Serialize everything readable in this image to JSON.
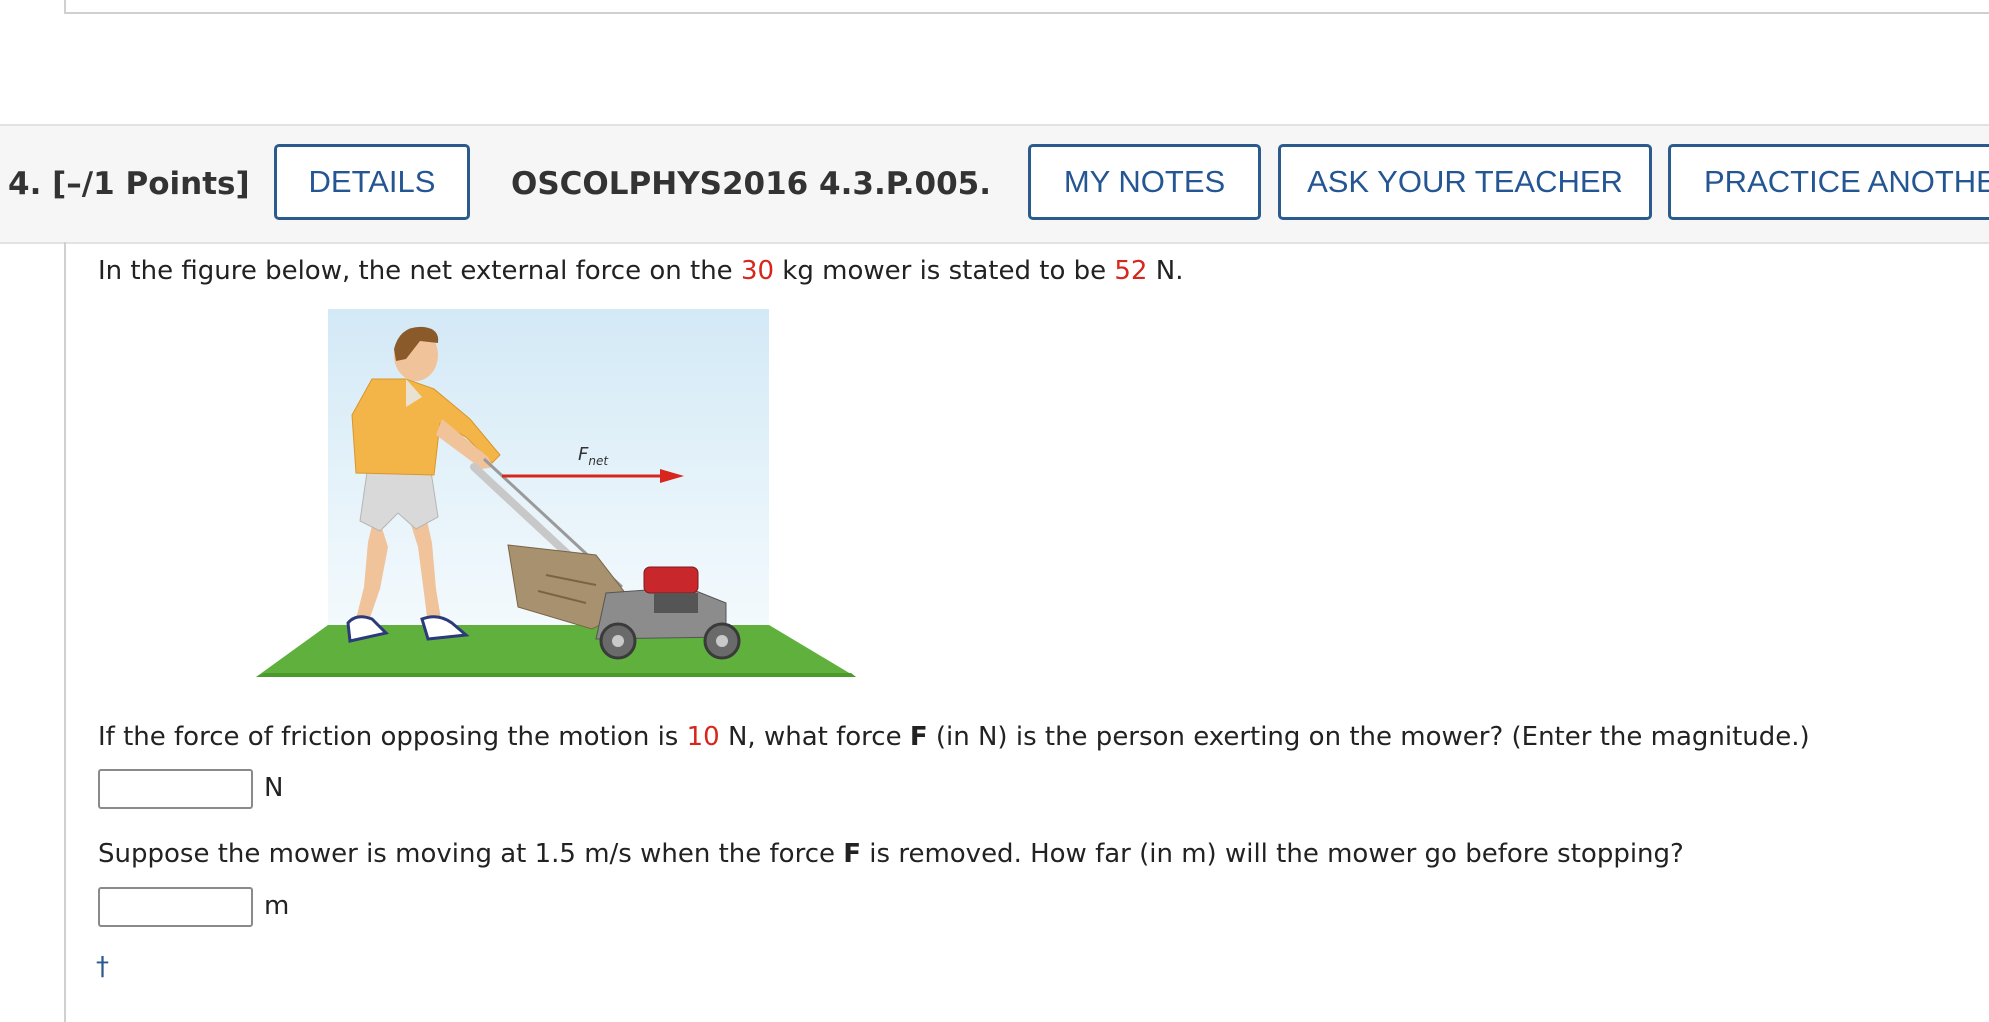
{
  "question": {
    "label": "4.  [–/1 Points]",
    "details_button": "DETAILS",
    "code": "OSCOLPHYS2016 4.3.P.005.",
    "my_notes_button": "MY NOTES",
    "ask_teacher_button": "ASK YOUR TEACHER",
    "practice_button": "PRACTICE ANOTHE"
  },
  "intro": {
    "prefix": "In the figure below, the net external force on the ",
    "mass": "30",
    "mid": " kg mower is stated to be ",
    "force": "52",
    "suffix": " N."
  },
  "figure": {
    "arrow_label": "F",
    "arrow_subscript": "net"
  },
  "part1": {
    "prefix": "If the force of friction opposing the motion is ",
    "friction": "10",
    "mid": " N, what force ",
    "bold": "F",
    "suffix": " (in N) is the person exerting on the mower? (Enter the magnitude.)",
    "unit": "N",
    "value": ""
  },
  "part2": {
    "prefix": "Suppose the mower is moving at 1.5 m/s when the force ",
    "bold": "F",
    "suffix": " is removed. How far (in m) will the mower go before stopping?",
    "unit": "m",
    "value": ""
  },
  "footnote_symbol": "†",
  "colors": {
    "accent": "#2b5a8e",
    "highlight": "#d8261c"
  }
}
